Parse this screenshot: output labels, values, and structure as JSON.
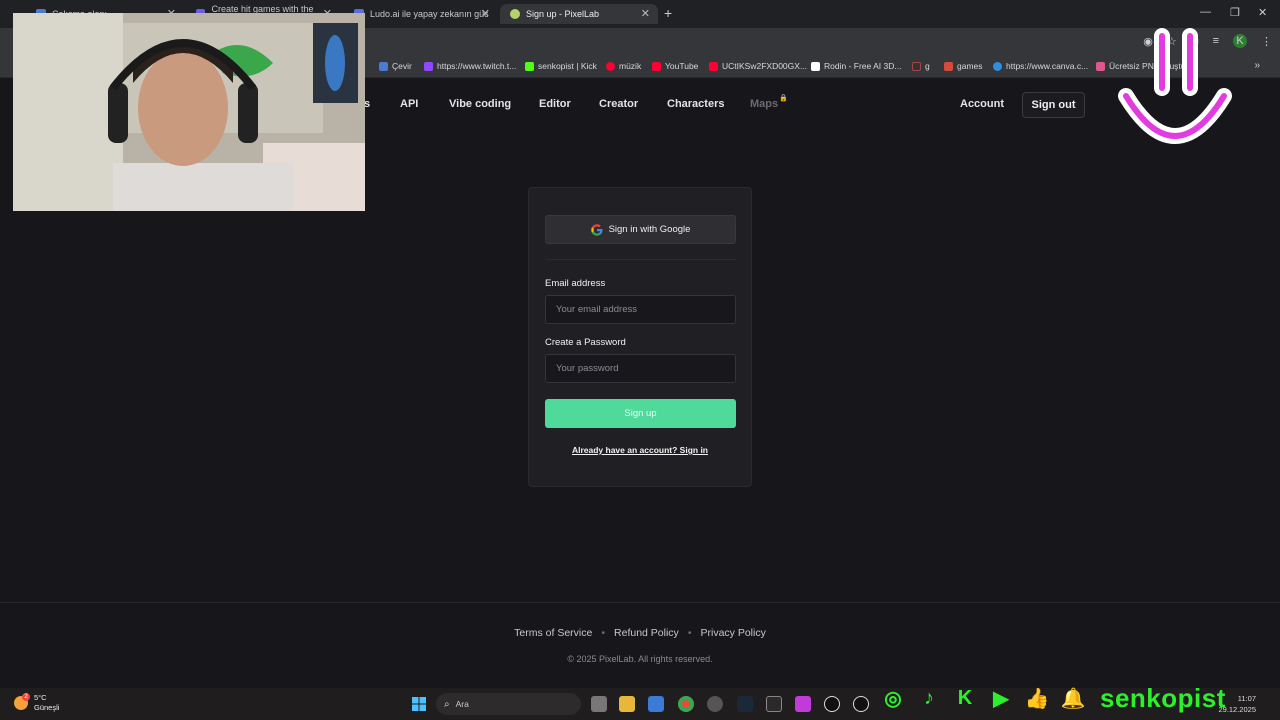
{
  "browser": {
    "tabs": [
      {
        "label": "Çalışma alanı",
        "active": false
      },
      {
        "label": "Create hit games with the power...",
        "active": false
      },
      {
        "label": "Ludo.ai ile yapay zekanın gücüyle...",
        "active": false
      },
      {
        "label": "Sign up - PixelLab",
        "active": true
      }
    ],
    "bookmarks": [
      {
        "label": "Çevir",
        "color": "#4a7bd0"
      },
      {
        "label": "https://www.twitch.t...",
        "color": "#9146ff"
      },
      {
        "label": "senkopist | Kick",
        "color": "#53fc18"
      },
      {
        "label": "müzik",
        "color": "#ff0033"
      },
      {
        "label": "YouTube",
        "color": "#ff0033"
      },
      {
        "label": "UCtIKSw2FXD00GX...",
        "color": "#ff0033"
      },
      {
        "label": "Rodin - Free AI 3D...",
        "color": "#ffffff"
      },
      {
        "label": "g",
        "color": "#333333"
      },
      {
        "label": "games",
        "color": "#d24b3b"
      },
      {
        "label": "https://www.canva.c...",
        "color": "#2f8de4"
      },
      {
        "label": "Ücretsiz PNG oluştur...",
        "color": "#e0568f"
      }
    ],
    "profile_initial": "K"
  },
  "nav": {
    "partial_item": "s",
    "items": [
      "API",
      "Vibe coding",
      "Editor",
      "Creator",
      "Characters",
      "Maps"
    ],
    "account_label": "Account",
    "signout_label": "Sign out"
  },
  "form": {
    "google_label": "Sign in with Google",
    "email_label": "Email address",
    "email_placeholder": "Your email address",
    "password_label": "Create a Password",
    "password_placeholder": "Your password",
    "signup_label": "Sign up",
    "signin_link": "Already have an account? Sign in"
  },
  "footer": {
    "terms": "Terms of Service",
    "refund": "Refund Policy",
    "privacy": "Privacy Policy",
    "copyright": "© 2025 PixelLab. All rights reserved."
  },
  "taskbar": {
    "weather_temp": "5°C",
    "weather_desc": "Güneşli",
    "weather_badge": "2",
    "search_label": "Ara",
    "time": "11:07",
    "date": "29.12.2025"
  },
  "overlay": {
    "channel_name": "senkopist"
  },
  "colors": {
    "signup_green": "#4fd99a",
    "overlay_green": "#2cf02c",
    "smiley_magenta": "#e23be0"
  }
}
